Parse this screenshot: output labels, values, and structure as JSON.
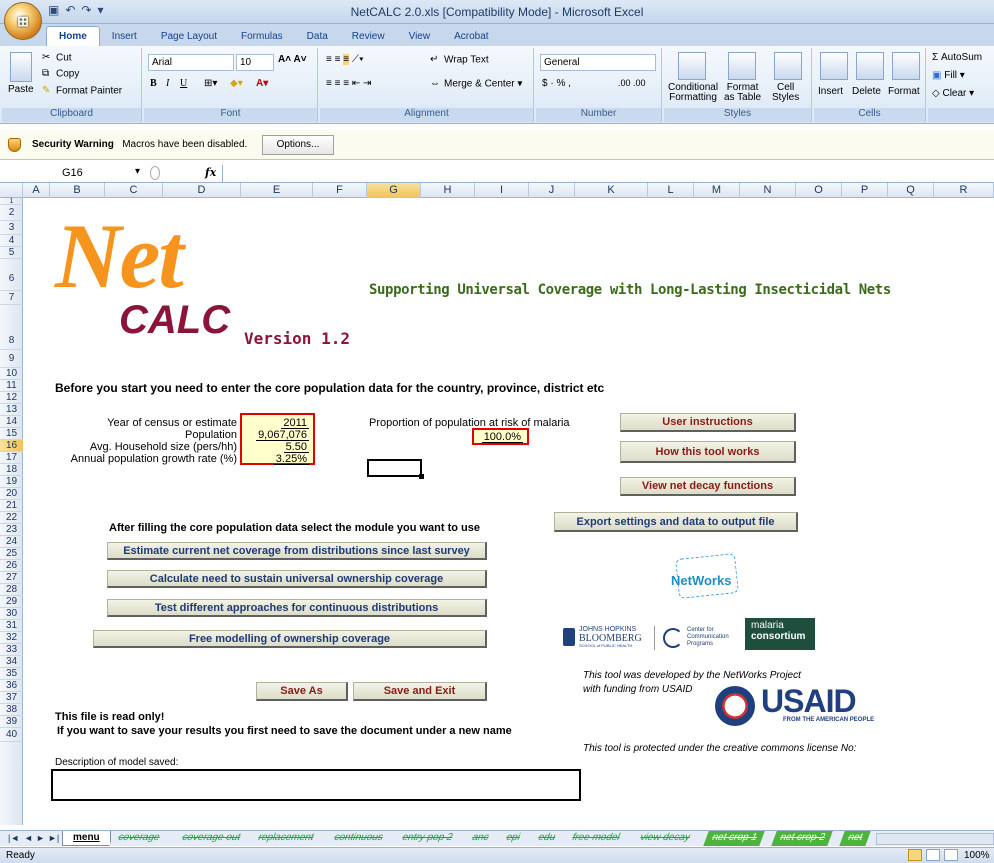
{
  "window": {
    "title": "NetCALC 2.0.xls  [Compatibility Mode] - Microsoft Excel"
  },
  "ribbon": {
    "tabs": [
      "Home",
      "Insert",
      "Page Layout",
      "Formulas",
      "Data",
      "Review",
      "View",
      "Acrobat"
    ],
    "clipboard": {
      "paste": "Paste",
      "cut": "Cut",
      "copy": "Copy",
      "format_painter": "Format Painter",
      "label": "Clipboard"
    },
    "font": {
      "name": "Arial",
      "size": "10",
      "label": "Font"
    },
    "alignment": {
      "wrap": "Wrap Text",
      "merge": "Merge & Center",
      "label": "Alignment"
    },
    "number": {
      "format": "General",
      "currency": "$ ·  %  ,",
      "decimals": ".00 .00",
      "label": "Number"
    },
    "styles": {
      "cond": "Conditional",
      "cond2": "Formatting",
      "fmt": "Format",
      "fmt2": "as Table",
      "cell": "Cell",
      "cell2": "Styles",
      "label": "Styles"
    },
    "cells": {
      "insert": "Insert",
      "delete": "Delete",
      "format": "Format",
      "label": "Cells"
    },
    "editing": {
      "autosum": "AutoSum",
      "fill": "Fill",
      "clear": "Clear"
    }
  },
  "security": {
    "title": "Security Warning",
    "message": "Macros have been disabled.",
    "options": "Options..."
  },
  "formula_bar": {
    "namebox": "G16",
    "fx": "fx"
  },
  "columns": [
    "A",
    "B",
    "C",
    "D",
    "E",
    "F",
    "G",
    "H",
    "I",
    "J",
    "K",
    "L",
    "M",
    "N",
    "O",
    "P",
    "Q",
    "R"
  ],
  "rows": [
    "1",
    "2",
    "3",
    "4",
    "5",
    "6",
    "7",
    "8",
    "9",
    "10",
    "11",
    "12",
    "13",
    "14",
    "15",
    "16",
    "17",
    "18",
    "19",
    "20",
    "21",
    "22",
    "23",
    "24",
    "25",
    "26",
    "27",
    "28",
    "29",
    "30",
    "31",
    "32",
    "33",
    "34",
    "35",
    "36",
    "37",
    "38",
    "39",
    "40"
  ],
  "sheet": {
    "logo_net": "Net",
    "logo_calc": "CALC",
    "version": "Version 1.2",
    "tagline": "Supporting Universal Coverage with Long-Lasting Insecticidal Nets",
    "intro": "Before you start you need to enter the core population data for the country, province, district etc",
    "labels": {
      "year": "Year of census or estimate",
      "population": "Population",
      "household": "Avg. Household size (pers/hh)",
      "growth": "Annual population growth rate (%)",
      "risk": "Proportion of population at risk of malaria"
    },
    "values": {
      "year": "2011",
      "population": "9,067,076",
      "household": "5.50",
      "growth": "3.25%",
      "risk": "100.0%"
    },
    "buttons": {
      "user_instructions": "User instructions",
      "how_it_works": "How this tool works",
      "decay": "View net decay functions",
      "export": "Export settings and data to output file",
      "estimate": "Estimate current net coverage from distributions since last survey",
      "calculate": "Calculate need to sustain universal ownership coverage",
      "test": "Test different approaches for continuous distributions",
      "free": "Free modelling of ownership coverage",
      "save_as": "Save As",
      "save_exit": "Save and Exit"
    },
    "module_prompt": "After filling the core population data select the module you want to use",
    "readonly": "This file is read only!",
    "readonly_note": "If you want to save your results you first need to save the document under a new name",
    "description_label": "Description of model saved:",
    "networks": "NetWorks",
    "jhu_1": "JOHNS HOPKINS",
    "jhu_2": "BLOOMBERG",
    "jhu_3": "SCHOOL of PUBLIC HEALTH",
    "ccp_1": "Center for",
    "ccp_2": "Communication",
    "ccp_3": "Programs",
    "mc_1": "malaria",
    "mc_2": "consortium",
    "developed": "This tool was developed by the NetWorks Project",
    "funding": "with funding from USAID",
    "usaid": "USAID",
    "usaid_sub": "FROM THE AMERICAN PEOPLE",
    "license": "This tool is protected under the creative commons license No:"
  },
  "sheet_tabs": [
    "menu",
    "coverage",
    "coverage out",
    "replacement",
    "continuous",
    "entry pop 2",
    "anc",
    "epi",
    "edu",
    "free model",
    "view decay",
    "net crop 1",
    "net crop 2",
    "net"
  ],
  "status": {
    "ready": "Ready",
    "zoom": "100%"
  },
  "colors": {
    "logo_orange": "#f7941d",
    "logo_maroon": "#8b1538",
    "tagline_green": "#3a6b1a",
    "red_border": "#e30000"
  }
}
